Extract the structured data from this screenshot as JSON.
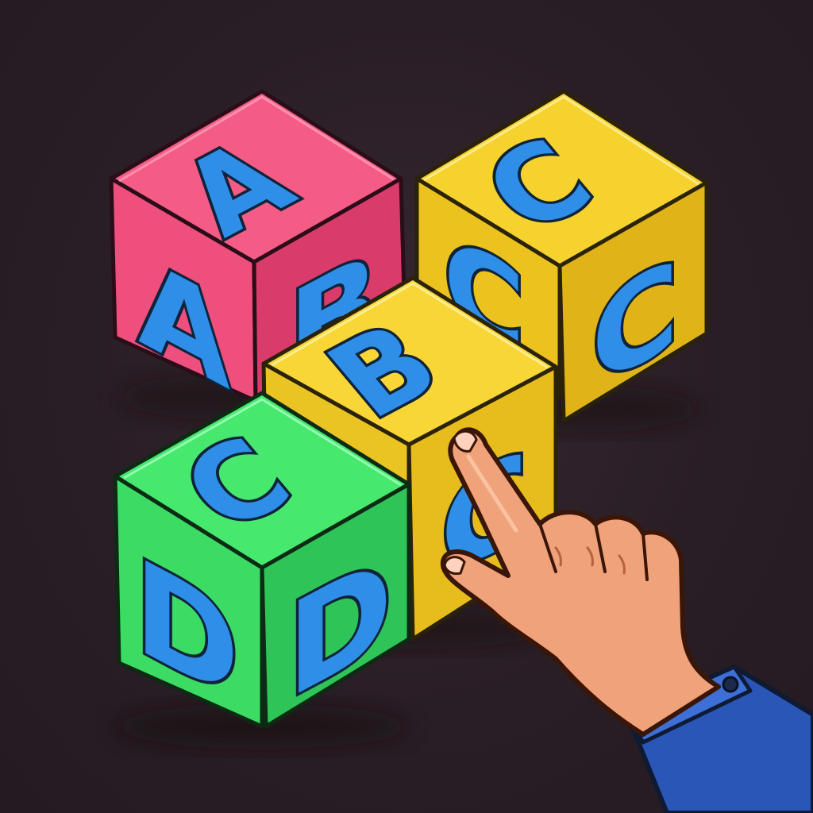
{
  "scene": {
    "background_color": "#2b1f27",
    "letter_color": "#2f8fe8",
    "skin_color": "#f0a27a",
    "sleeve_color": "#2a56b8"
  },
  "cubes": [
    {
      "name": "pink",
      "color": "#f25a86",
      "letters": {
        "top": "A",
        "left": "A",
        "right": "B"
      }
    },
    {
      "name": "yellow-back",
      "color": "#f2c82a",
      "letters": {
        "top": "C",
        "left": "C",
        "right": "C"
      }
    },
    {
      "name": "yellow-front",
      "color": "#f4c92c",
      "letters": {
        "top": "B",
        "right": "C"
      }
    },
    {
      "name": "green",
      "color": "#3ee46a",
      "letters": {
        "top": "C",
        "left": "D",
        "right": "D"
      }
    }
  ]
}
